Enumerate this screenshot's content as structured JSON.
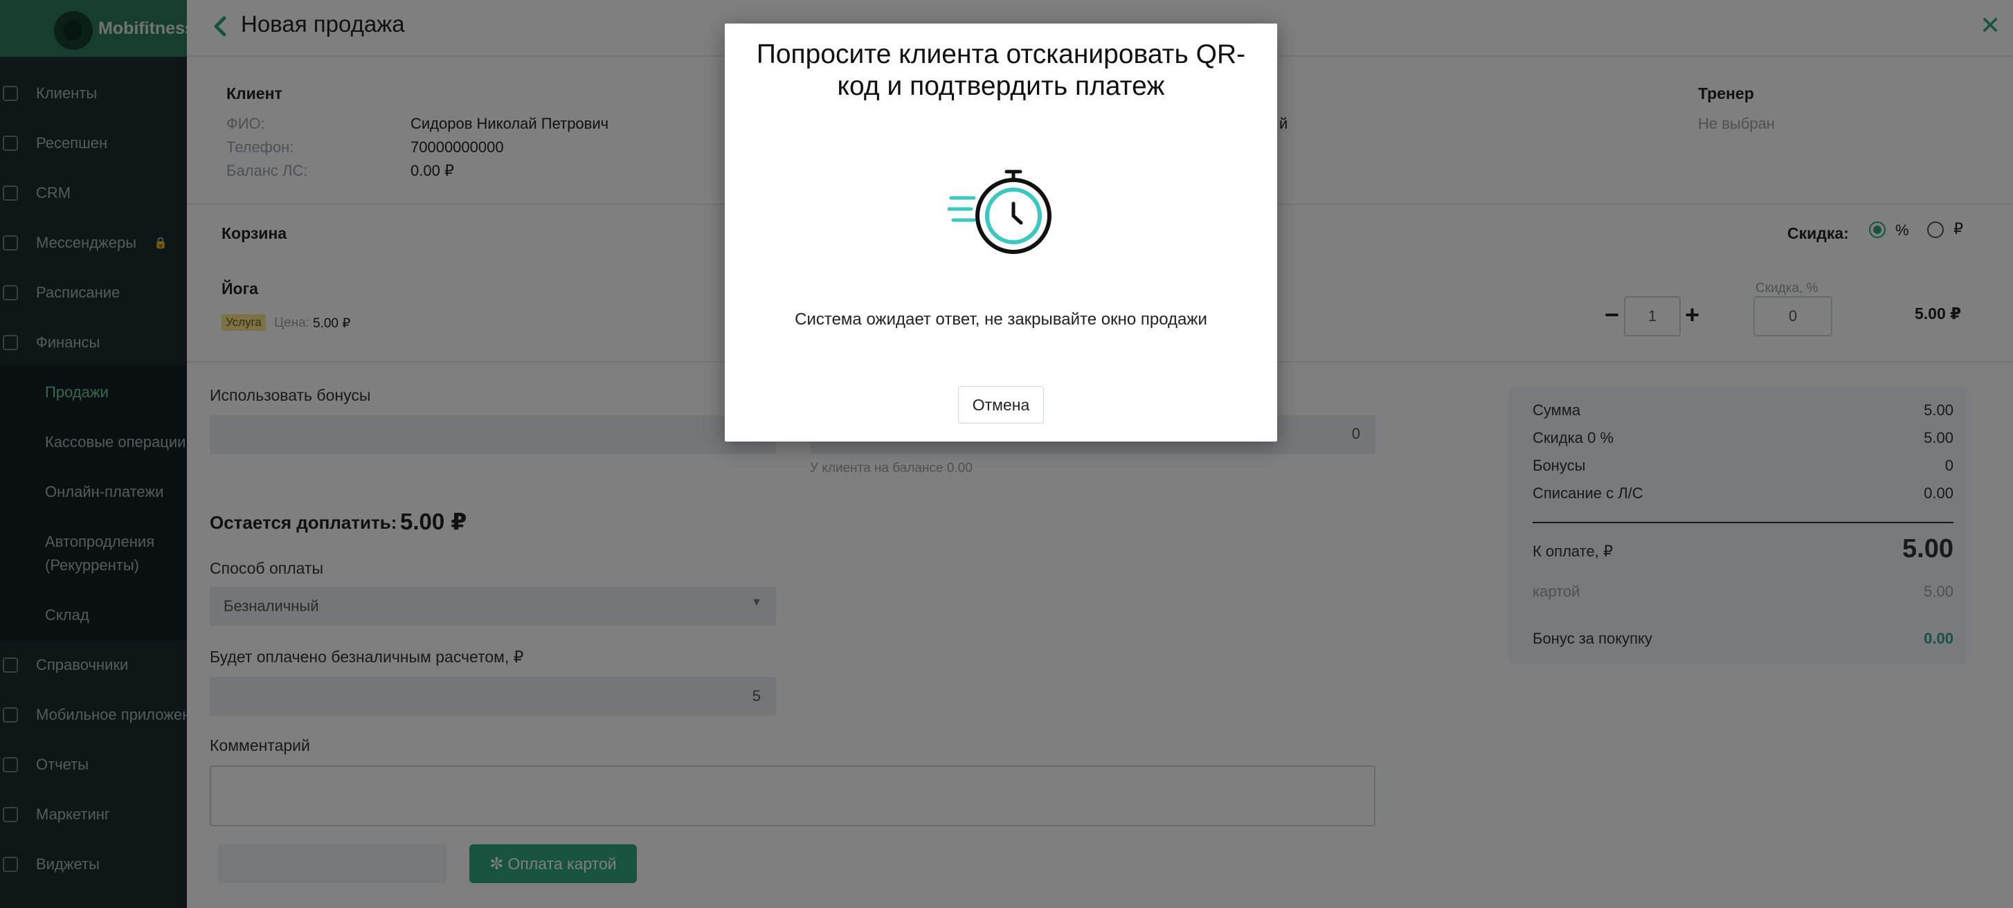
{
  "brand": "Mobifitness",
  "sidebar": {
    "items": [
      {
        "label": "Клиенты"
      },
      {
        "label": "Ресепшен"
      },
      {
        "label": "CRM"
      },
      {
        "label": "Мессенджеры"
      },
      {
        "label": "Расписание"
      },
      {
        "label": "Финансы"
      }
    ],
    "finance_sub": [
      {
        "label": "Продажи"
      },
      {
        "label": "Кассовые операции"
      },
      {
        "label": "Онлайн-платежи"
      },
      {
        "label": "Автопродления"
      },
      {
        "label": "(Рекурренты)"
      },
      {
        "label": "Склад"
      }
    ],
    "items_after": [
      {
        "label": "Справочники"
      },
      {
        "label": "Мобильное приложение"
      },
      {
        "label": "Отчеты"
      },
      {
        "label": "Маркетинг"
      },
      {
        "label": "Виджеты"
      }
    ]
  },
  "page": {
    "title": "Новая продажа"
  },
  "client": {
    "section": "Клиент",
    "fio_label": "ФИО:",
    "fio": "Сидоров Николай Петрович",
    "phone_label": "Телефон:",
    "phone": "70000000000",
    "balance_label": "Баланс ЛС:",
    "balance": "0.00 ₽",
    "partial": "й"
  },
  "trainer": {
    "section": "Тренер",
    "value": "Не выбран"
  },
  "cart": {
    "section": "Корзина",
    "discount_label": "Скидка:",
    "discount_pct": "%",
    "discount_rub": "₽",
    "item_name": "Йога",
    "item_badge": "Услуга",
    "price_label": "Цена:",
    "price": "5.00 ₽",
    "qty": "1",
    "qty_minus": "−",
    "qty_plus": "+",
    "disc_input_label": "Скидка, %",
    "disc_value": "0",
    "line_total": "5.00 ₽"
  },
  "bonuses": {
    "label": "Использовать бонусы",
    "balance_value": "0",
    "balance_note": "У клиента на балансе 0.00"
  },
  "remain": {
    "label": "Остается доплатить:",
    "amount": "5.00 ₽"
  },
  "payment": {
    "method_label": "Способ оплаты",
    "method": "Безналичный",
    "cashless_label": "Будет оплачено безналичным расчетом, ₽",
    "cashless_value": "5",
    "comment_label": "Комментарий",
    "pay_button": "Оплата картой"
  },
  "summary": {
    "sum_label": "Сумма",
    "sum": "5.00",
    "discount_label": "Скидка 0 %",
    "discount": "5.00",
    "bonus_label": "Бонусы",
    "bonus": "0",
    "writeoff_label": "Списание с Л/С",
    "writeoff": "0.00",
    "topay_label": "К оплате, ₽",
    "topay": "5.00",
    "card_label": "картой",
    "card": "5.00",
    "reward_label": "Бонус за покупку",
    "reward": "0.00"
  },
  "modal": {
    "title": "Попросите клиента отсканировать QR-код и подтвердить платеж",
    "message": "Система ожидает ответ, не закрывайте окно продажи",
    "cancel": "Отмена"
  },
  "colors": {
    "accent": "#2fa77c",
    "sidebar": "#1d2d30",
    "brand": "#2e7a5c"
  },
  "icons": [
    "back-chevron-icon",
    "close-icon",
    "stopwatch-icon",
    "lock-icon",
    "dropdown-caret-icon",
    "spinner-icon"
  ]
}
